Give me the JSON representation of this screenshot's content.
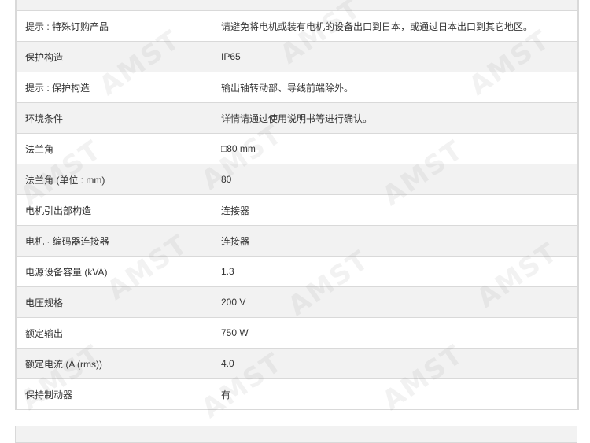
{
  "rows": [
    {
      "label": "",
      "value": ""
    },
    {
      "label": "提示 : 特殊订购产品",
      "value": "请避免将电机或装有电机的设备出口到日本，或通过日本出口到其它地区。"
    },
    {
      "label": "保护构造",
      "value": "IP65"
    },
    {
      "label": "提示 : 保护构造",
      "value": "输出轴转动部、导线前端除外。"
    },
    {
      "label": "环境条件",
      "value": "详情请通过使用说明书等进行确认。"
    },
    {
      "label": "法兰角",
      "value": "□80 mm"
    },
    {
      "label": "法兰角 (单位 : mm)",
      "value": "80"
    },
    {
      "label": "电机引出部构造",
      "value": "连接器"
    },
    {
      "label": "电机 · 编码器连接器",
      "value": "连接器"
    },
    {
      "label": "电源设备容量 (kVA)",
      "value": "1.3"
    },
    {
      "label": "电压规格",
      "value": "200 V"
    },
    {
      "label": "额定输出",
      "value": "750 W"
    },
    {
      "label": "额定电流 (A (rms))",
      "value": "4.0"
    },
    {
      "label": "保持制动器",
      "value": "有"
    }
  ],
  "watermark": {
    "text": "AMST"
  }
}
